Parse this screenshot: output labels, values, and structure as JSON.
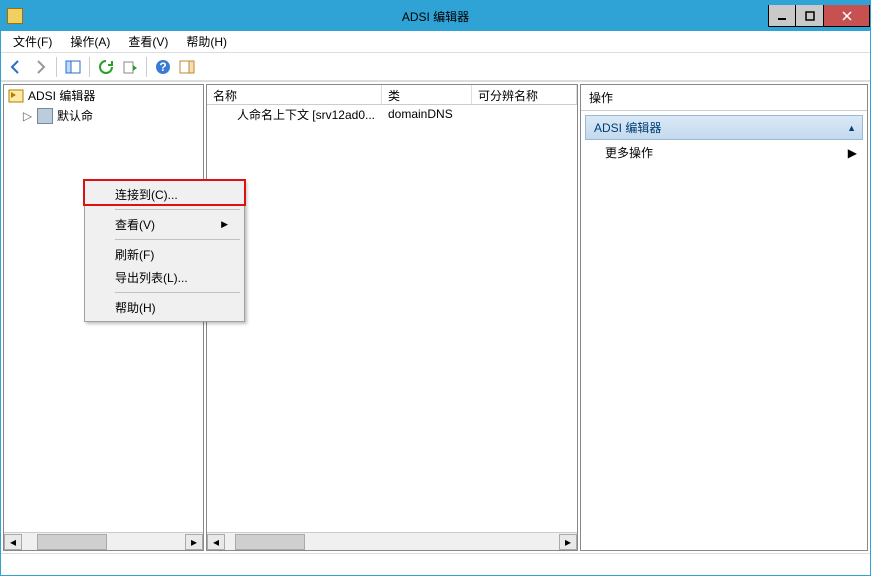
{
  "window": {
    "title": "ADSI 编辑器"
  },
  "menubar": {
    "file": "文件(F)",
    "action": "操作(A)",
    "view": "查看(V)",
    "help": "帮助(H)"
  },
  "tree": {
    "root_label": "ADSI 编辑器",
    "child_label_prefix": "默认命"
  },
  "columns": {
    "name": "名称",
    "class": "类",
    "dn": "可分辨名称"
  },
  "list": {
    "row0": {
      "name_visible": "人命名上下文 [srv12ad0...",
      "class": "domainDNS",
      "dn": ""
    }
  },
  "actions": {
    "header": "操作",
    "group_title": "ADSI 编辑器",
    "more": "更多操作"
  },
  "context_menu": {
    "connect": "连接到(C)...",
    "view": "查看(V)",
    "refresh": "刷新(F)",
    "export": "导出列表(L)...",
    "help": "帮助(H)"
  },
  "scrollbar_thumb_label": "|||"
}
